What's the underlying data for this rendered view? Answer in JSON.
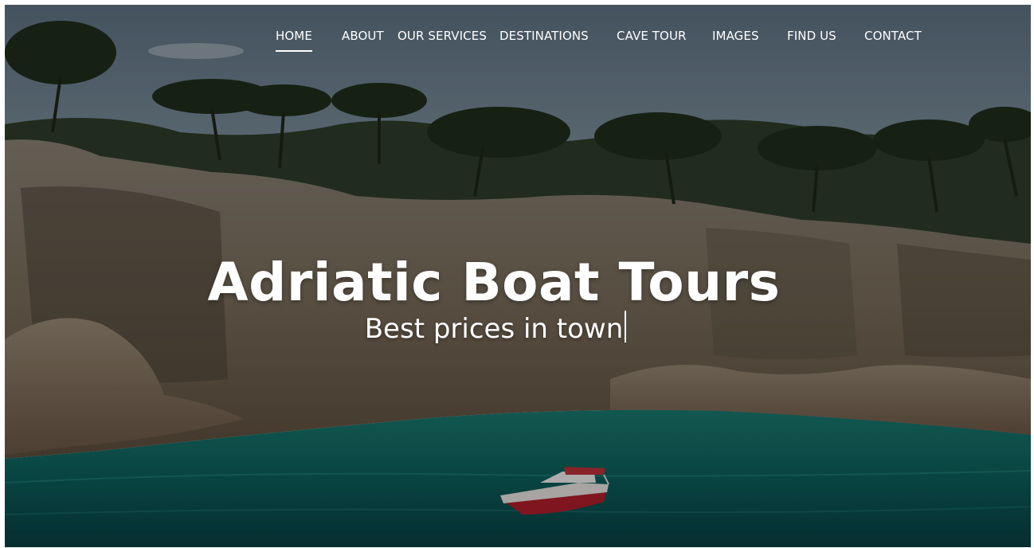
{
  "nav": {
    "items": [
      {
        "label": "HOME",
        "active": true
      },
      {
        "label": "ABOUT",
        "active": false
      },
      {
        "label": "OUR SERVICES",
        "active": false
      },
      {
        "label": "DESTINATIONS",
        "active": false
      },
      {
        "label": "CAVE TOUR",
        "active": false
      },
      {
        "label": "IMAGES",
        "active": false
      },
      {
        "label": "FIND US",
        "active": false
      },
      {
        "label": "CONTACT",
        "active": false
      }
    ]
  },
  "hero": {
    "title": "Adriatic Boat Tours",
    "subtitle": "Best prices in town"
  },
  "colors": {
    "nav_text": "#ffffff",
    "sea": "#0e6a66",
    "sky": "#7a8ea0",
    "boat_hull": "#b01e2a"
  },
  "icons": {
    "cursor": "text-cursor-icon"
  }
}
